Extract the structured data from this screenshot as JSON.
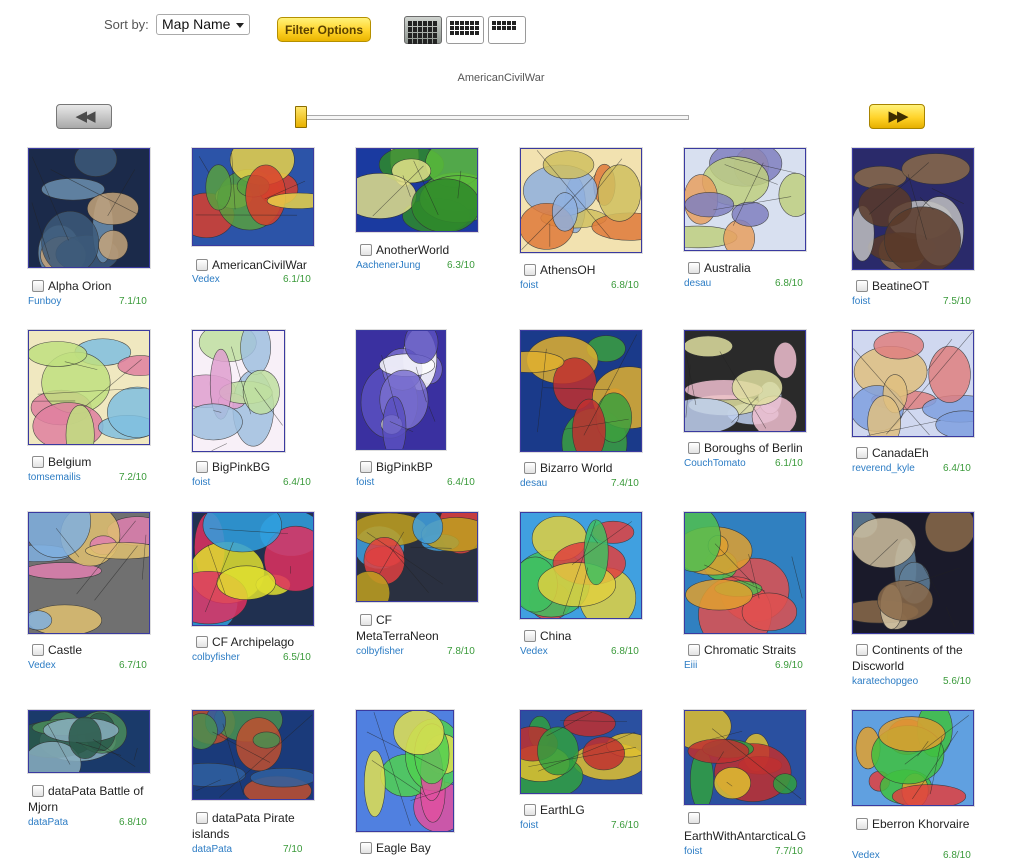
{
  "toolbar": {
    "sort_label": "Sort by:",
    "sort_value": "Map Name",
    "filter_label": "Filter Options",
    "view_buttons": [
      {
        "name": "large-grid-view",
        "active": true
      },
      {
        "name": "medium-grid-view",
        "active": false
      },
      {
        "name": "small-grid-view",
        "active": false
      }
    ]
  },
  "carousel": {
    "current_map": "AmericanCivilWar",
    "prev_glyph": "◀◀",
    "next_glyph": "▶▶",
    "slider_position": 0.0
  },
  "maps": [
    {
      "name": "Alpha Orion",
      "author": "Funboy",
      "rating": "7.1/10",
      "colors": [
        "#1b2a4a",
        "#6b8fb0",
        "#c4a37a",
        "#3c5a7a"
      ]
    },
    {
      "name": "AmericanCivilWar",
      "author": "Vedex",
      "rating": "6.1/10",
      "colors": [
        "#2c54a8",
        "#d8402d",
        "#e8d24a",
        "#58a040"
      ]
    },
    {
      "name": "AnotherWorld",
      "author": "AachenerJung",
      "rating": "6.3/10",
      "colors": [
        "#1a3aa0",
        "#5cbc3c",
        "#e2e08a",
        "#2f8a2a"
      ]
    },
    {
      "name": "AthensOH",
      "author": "foist",
      "rating": "6.8/10",
      "colors": [
        "#f2e2b0",
        "#e07a3a",
        "#8fb0e0",
        "#d0c060"
      ]
    },
    {
      "name": "Australia",
      "author": "desau",
      "rating": "6.8/10",
      "colors": [
        "#d8e0f0",
        "#e8a060",
        "#8080c0",
        "#c0d080"
      ]
    },
    {
      "name": "BeatineOT",
      "author": "foist",
      "rating": "7.5/10",
      "colors": [
        "#2a2a6a",
        "#8a6a4a",
        "#c0c0c0",
        "#5a3a2a"
      ]
    },
    {
      "name": "Belgium",
      "author": "tomsemailis",
      "rating": "7.2/10",
      "colors": [
        "#f0e8c0",
        "#e080a0",
        "#80c0e0",
        "#c0e080"
      ]
    },
    {
      "name": "BigPinkBG",
      "author": "foist",
      "rating": "6.4/10",
      "colors": [
        "#f8f0f8",
        "#e0a0d0",
        "#a0c0e0",
        "#c0e0a0"
      ]
    },
    {
      "name": "BigPinkBP",
      "author": "foist",
      "rating": "6.4/10",
      "colors": [
        "#3a30a0",
        "#7a70d0",
        "#ffffff",
        "#5a50c0"
      ]
    },
    {
      "name": "Bizarro World",
      "author": "desau",
      "rating": "7.4/10",
      "colors": [
        "#1a3a8a",
        "#3aa040",
        "#c03030",
        "#e0b030"
      ]
    },
    {
      "name": "Boroughs of Berlin",
      "author": "CouchTomato",
      "rating": "6.1/10",
      "colors": [
        "#2a2a2a",
        "#c0d0f0",
        "#f0c0d0",
        "#e0e0a0"
      ]
    },
    {
      "name": "CanadaEh",
      "author": "reverend_kyle",
      "rating": "6.4/10",
      "colors": [
        "#d0d8f0",
        "#e08080",
        "#80a0e0",
        "#e0c080"
      ]
    },
    {
      "name": "Castle",
      "author": "Vedex",
      "rating": "6.7/10",
      "colors": [
        "#707070",
        "#e080b0",
        "#80b0e0",
        "#e0c070"
      ]
    },
    {
      "name": "CF Archipelago",
      "author": "colbyfisher",
      "rating": "6.5/10",
      "colors": [
        "#203050",
        "#e03060",
        "#30a0e0",
        "#e0e030"
      ]
    },
    {
      "name": "CF MetaTerraNeon",
      "author": "colbyfisher",
      "rating": "7.8/10",
      "colors": [
        "#2a3040",
        "#e04040",
        "#40a0e0",
        "#c0a020"
      ]
    },
    {
      "name": "China",
      "author": "Vedex",
      "rating": "6.8/10",
      "colors": [
        "#40a0e0",
        "#e0d040",
        "#e04040",
        "#40c060"
      ]
    },
    {
      "name": "Chromatic Straits",
      "author": "Eiii",
      "rating": "6.9/10",
      "colors": [
        "#3080c0",
        "#e05050",
        "#50c050",
        "#e0a030"
      ]
    },
    {
      "name": "Continents of the Discworld",
      "author": "karatechopgeo",
      "rating": "5.6/10",
      "colors": [
        "#1a1a2a",
        "#60809a",
        "#d0c0a0",
        "#8a6a4a"
      ]
    },
    {
      "name": "dataPata Battle of Mjorn",
      "author": "dataPata",
      "rating": "6.8/10",
      "colors": [
        "#1a3a6a",
        "#4a8a5a",
        "#8ab0c0",
        "#2a5a4a"
      ]
    },
    {
      "name": "dataPata Pirate islands",
      "author": "dataPata",
      "rating": "7/10",
      "colors": [
        "#1a3a7a",
        "#c05030",
        "#4a9050",
        "#3060a0"
      ]
    },
    {
      "name": "Eagle Bay",
      "author": "",
      "rating": "",
      "colors": [
        "#5080e0",
        "#e050a0",
        "#50d050",
        "#e0e050"
      ]
    },
    {
      "name": "EarthLG",
      "author": "foist",
      "rating": "7.6/10",
      "colors": [
        "#2a50a0",
        "#e0c030",
        "#c03030",
        "#30a040"
      ]
    },
    {
      "name": "EarthWithAntarcticaLG",
      "author": "foist",
      "rating": "7.7/10",
      "colors": [
        "#2a50a0",
        "#e0c030",
        "#c03030",
        "#30a040"
      ]
    },
    {
      "name": "Eberron Khorvaire",
      "author": "Vedex",
      "rating": "6.8/10",
      "colors": [
        "#60a0e0",
        "#e04040",
        "#40c040",
        "#e0a030"
      ]
    }
  ]
}
